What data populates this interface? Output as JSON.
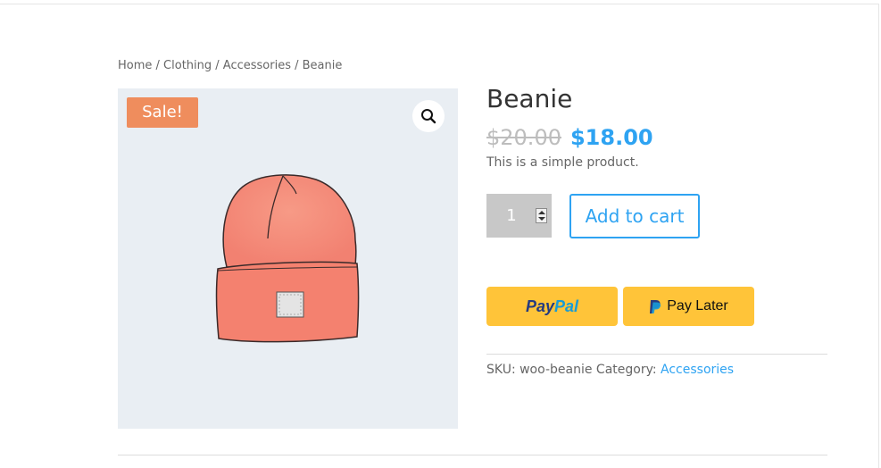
{
  "breadcrumb": {
    "items": [
      "Home",
      "Clothing",
      "Accessories"
    ],
    "separator": " / ",
    "current": "Beanie"
  },
  "gallery": {
    "sale_badge": "Sale!",
    "zoom_icon": "search-icon",
    "image": "beanie-illustration",
    "badge_color": "#ef8d5d"
  },
  "product": {
    "title": "Beanie",
    "regular_price": "$20.00",
    "sale_price": "$18.00",
    "short_description": "This is a simple product.",
    "quantity": "1",
    "add_to_cart_label": "Add to cart",
    "accent_color": "#2ea3f2"
  },
  "payments": {
    "paypal_label_1": "Pay",
    "paypal_label_2": "Pal",
    "pay_later_label": "Pay Later",
    "button_color": "#ffc439"
  },
  "meta": {
    "sku_label": "SKU:",
    "sku_value": "woo-beanie",
    "category_label": "Category:",
    "category_value": "Accessories"
  }
}
